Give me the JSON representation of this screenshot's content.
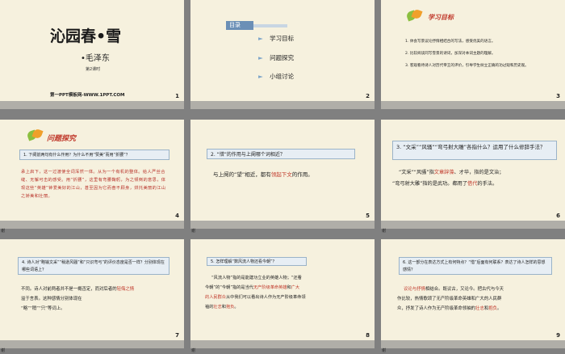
{
  "slides": [
    {
      "n": "1",
      "title": "沁园春•雪",
      "author": "•毛泽东",
      "sub": "第2课时",
      "brand": "第一PPT模板网-WWW.1PPT.COM"
    },
    {
      "n": "2",
      "menu_label": "目录",
      "items": [
        "学习目标",
        "问题探究",
        "小组讨论"
      ]
    },
    {
      "n": "3",
      "heading": "学习目标",
      "goals": [
        "1. 体会写景议论抒情相结合的写法，感受优美的语言。",
        "2. 比较阅读同写雪景的诗词，加深对本词主题的理解。",
        "3. 客观看待诗人对历代帝王的评价，引导学生树立正确的功过观和历史观。"
      ]
    },
    {
      "n": "4",
      "heading": "问题探究",
      "question": "1. 下阕前两句有什么作用？为什么不用“赞美”而用“折腰”？",
      "answer": "承上启下，这一过渡使全词浑然一体。从为一个有机的整体。给人严丝合缝、无懈可击的感受。用“折腰”，这里有弯腰鞠躬，为之倾倒的意思，体现这些“英雄”钟爱美好的江山，甚至因为它而奋不顾身，烘托美丽的江山之娇美和壮丽。"
    },
    {
      "n": "5",
      "question": "2. “惜”的作用与上阕哪个词相近？",
      "answer_pre": "与上阕的“望”相近，都有",
      "answer_red": "领起下文",
      "answer_post": "的作用。"
    },
    {
      "n": "6",
      "question": "3. “文采”“风骚”“弯弓射大雕”各指什么？运用了什么修辞手法？",
      "ans1_pre": "“文采”“风骚”指",
      "ans1_red1": "文章辞藻",
      "ans1_mid": "、才华，指的是文治；",
      "ans1_b": "“弯弓射大雕”指的是武功。都用了",
      "ans1_red2": "借代",
      "ans1_end": "的手法。",
      "left_label": "谢"
    },
    {
      "n": "7",
      "question": "4. 诗人对“略输文采”“稍逊风骚”和“只识弯弓”的评价态度是否一样？分别体现在哪些词语上？",
      "ans_pre": "不同。诗人对前两者并不是一概否定，而对后者的",
      "ans_red": "轻侮之情",
      "ans_post": "溢于言表。这种感情分别体现在",
      "words": "“略”“稍”“只”等词上。",
      "left_label": "谢"
    },
    {
      "n": "8",
      "question": "5. 怎样理解“数风流人物还看今朝”？",
      "l1_pre": "“风流人物”指的是能建功立业的英雄人物；“还看",
      "l2_pre": "今朝”的“今朝”指的是当代",
      "l2_red1": "无产阶级革命英雄",
      "l2_mid": "和",
      "l2_red2": "广大",
      "l3_red": "的人民群众",
      "l3_post": "从中我们可以看出诗人作为无产阶级革命领",
      "l4_pre": "袖的",
      "l4_red1": "壮志",
      "l4_mid": "和",
      "l4_red2": "抱负",
      "l4_end": "。"
    },
    {
      "n": "9",
      "question": "6. 这一部分在表达方式上有何特点？“惜”后面有何联系？表达了诗人怎样的思想感情？",
      "l1_red": "议论与抒情",
      "l1_post": "相结合。既议古，又论今。把古代与今天",
      "l2": "作比较，热情歌颂了无产阶级革命英雄和广大的人民群",
      "l3": "众，抒发了诗人作为无产阶级革命领袖的",
      "l3_red1": "壮志",
      "l3_mid": "和",
      "l3_red2": "抱负",
      "l3_end": "。",
      "left_label": "谢"
    }
  ]
}
